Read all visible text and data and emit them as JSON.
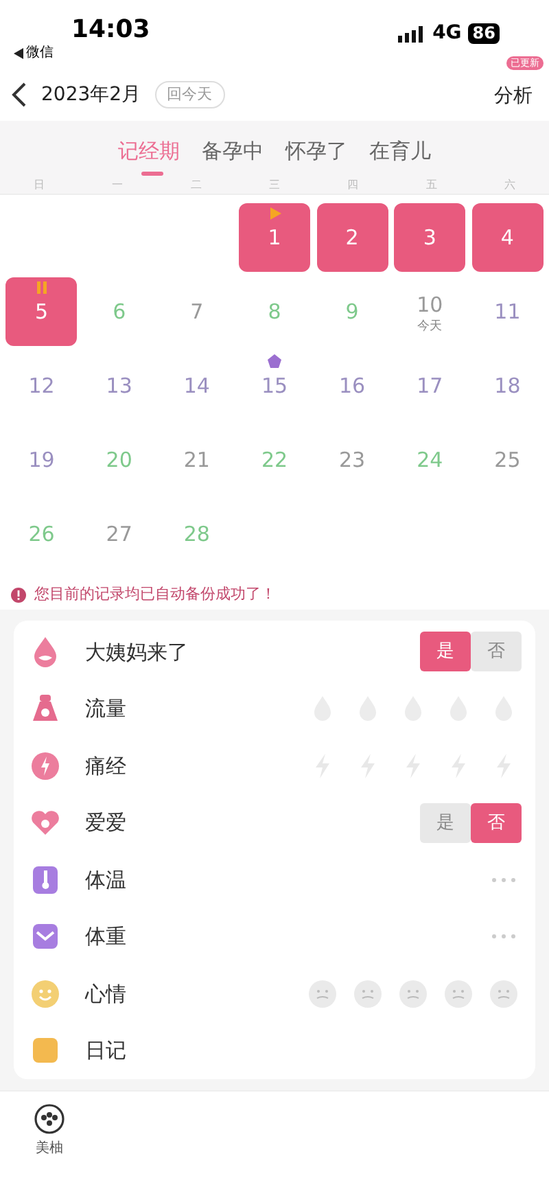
{
  "status_bar": {
    "time": "14:03",
    "back_label": "微信",
    "network": "4G",
    "battery": "86"
  },
  "header": {
    "month": "2023年2月",
    "today_button": "回今天",
    "analysis": {
      "label": "分析",
      "badge": "已更新"
    }
  },
  "mode_tabs": [
    {
      "label": "记经期",
      "selected": true
    },
    {
      "label": "备孕中",
      "selected": false
    },
    {
      "label": "怀孕了",
      "selected": false
    },
    {
      "label": "在育儿",
      "selected": false
    }
  ],
  "weekdays": [
    "日",
    "一",
    "二",
    "三",
    "四",
    "五",
    "六"
  ],
  "days": [
    {
      "kind": "blank"
    },
    {
      "kind": "blank"
    },
    {
      "kind": "blank"
    },
    {
      "day": "1",
      "kind": "period",
      "marker": {
        "kind": "start"
      }
    },
    {
      "day": "2",
      "kind": "period"
    },
    {
      "day": "3",
      "kind": "period"
    },
    {
      "day": "4",
      "kind": "period"
    },
    {
      "day": "5",
      "kind": "period",
      "marker": {
        "kind": "end"
      }
    },
    {
      "day": "6",
      "kind": "fertile"
    },
    {
      "day": "7",
      "kind": "normal"
    },
    {
      "day": "8",
      "kind": "fertile"
    },
    {
      "day": "9",
      "kind": "fertile"
    },
    {
      "day": "10",
      "kind": "normal",
      "note": "今天"
    },
    {
      "day": "11",
      "kind": "safe"
    },
    {
      "day": "12",
      "kind": "safe"
    },
    {
      "day": "13",
      "kind": "safe"
    },
    {
      "day": "14",
      "kind": "safe"
    },
    {
      "day": "15",
      "kind": "safe",
      "marker": {
        "kind": "ovulation"
      }
    },
    {
      "day": "16",
      "kind": "safe"
    },
    {
      "day": "17",
      "kind": "safe"
    },
    {
      "day": "18",
      "kind": "safe"
    },
    {
      "day": "19",
      "kind": "safe"
    },
    {
      "day": "20",
      "kind": "fertile"
    },
    {
      "day": "21",
      "kind": "normal"
    },
    {
      "day": "22",
      "kind": "fertile"
    },
    {
      "day": "23",
      "kind": "normal"
    },
    {
      "day": "24",
      "kind": "fertile"
    },
    {
      "day": "25",
      "kind": "normal"
    },
    {
      "day": "26",
      "kind": "fertile"
    },
    {
      "day": "27",
      "kind": "normal"
    },
    {
      "day": "28",
      "kind": "fertile"
    }
  ],
  "notice": "您目前的记录均已自动备份成功了！",
  "records": [
    {
      "label": "大姨妈来了",
      "kind": "toggle",
      "options": [
        {
          "label": "是",
          "selected": true
        },
        {
          "label": "否",
          "selected": false
        }
      ]
    },
    {
      "label": "流量",
      "kind": "drops"
    },
    {
      "label": "痛经",
      "kind": "bolts"
    },
    {
      "label": "爱爱",
      "kind": "toggle",
      "options": [
        {
          "label": "是",
          "selected": false
        },
        {
          "label": "否",
          "selected": true
        }
      ]
    },
    {
      "label": "体温",
      "kind": "more"
    },
    {
      "label": "体重",
      "kind": "more"
    },
    {
      "label": "心情",
      "kind": "faces"
    },
    {
      "label": "日记",
      "kind": "plain"
    }
  ],
  "tab_bar": [
    {
      "label": "美柚"
    }
  ]
}
